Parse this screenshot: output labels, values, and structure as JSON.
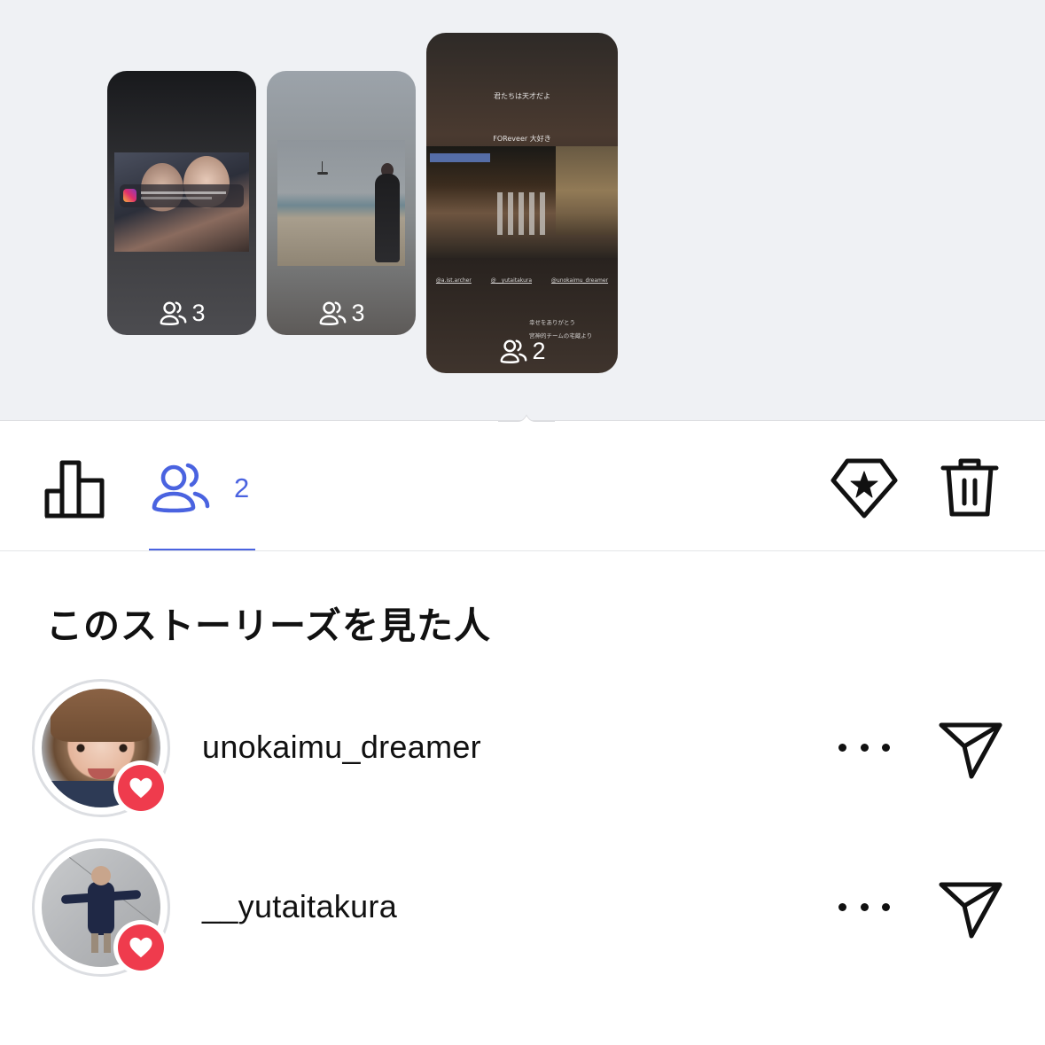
{
  "stories": [
    {
      "viewer_count": "3"
    },
    {
      "viewer_count": "3"
    },
    {
      "viewer_count": "2",
      "overlay_lines": [
        "君たちは天才だよ",
        "FOReveer 大好き"
      ],
      "tags": [
        "@a.ist.archer",
        "@__yutaitakura",
        "@unokaimu_dreamer"
      ],
      "caption_lines": [
        "幸せをありがとう",
        "宮神的チームの宅蔵より"
      ]
    }
  ],
  "toolbar": {
    "insights_icon": "bar-chart-icon",
    "viewers_icon": "people-icon",
    "viewers_count": "2",
    "highlight_icon": "highlight-icon",
    "delete_icon": "trash-icon",
    "accent_color": "#4a63e0"
  },
  "viewers_section": {
    "title": "このストーリーズを見た人",
    "viewers": [
      {
        "username": "unokaimu_dreamer",
        "liked": true
      },
      {
        "username": "__yutaitakura",
        "liked": true
      }
    ]
  },
  "colors": {
    "tray_background": "#eff1f4",
    "like_badge": "#ef3b4d",
    "text": "#111111"
  }
}
